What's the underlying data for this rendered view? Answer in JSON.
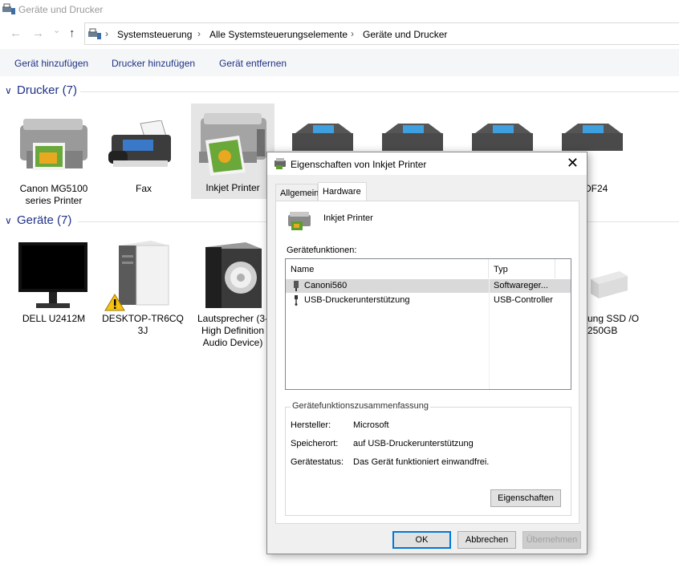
{
  "window": {
    "title": "Geräte und Drucker"
  },
  "nav": {
    "back": "←",
    "forward": "→",
    "dropdown": "⌄",
    "up": "↑"
  },
  "breadcrumb": [
    "Systemsteuerung",
    "Alle Systemsteuerungselemente",
    "Geräte und Drucker"
  ],
  "commands": [
    "Gerät hinzufügen",
    "Drucker hinzufügen",
    "Gerät entfernen"
  ],
  "groups": {
    "printers": {
      "title": "Drucker (7)",
      "chevron": "∨"
    },
    "devices": {
      "title": "Geräte (7)",
      "chevron": "∨"
    }
  },
  "printers": [
    {
      "label": "Canon MG5100 series Printer",
      "icon": "multifunction-printer-icon"
    },
    {
      "label": "Fax",
      "icon": "fax-icon"
    },
    {
      "label": "Inkjet Printer",
      "icon": "inkjet-printer-icon",
      "selected": true
    },
    {
      "label": "",
      "icon": "printer-icon"
    },
    {
      "label": "",
      "icon": "printer-icon"
    },
    {
      "label": "",
      "icon": "printer-icon"
    },
    {
      "label": "DF24",
      "icon": "printer-icon"
    }
  ],
  "devices": [
    {
      "label": "DELL U2412M",
      "icon": "monitor-icon"
    },
    {
      "label": "DESKTOP-TR6CQ 3J",
      "icon": "computer-tower-icon",
      "warning": true
    },
    {
      "label": "Lautsprecher (3- High Definition Audio Device)",
      "icon": "speaker-icon"
    },
    {
      "label": "ung SSD /O 250GB",
      "icon": "ssd-drive-icon"
    }
  ],
  "dialog": {
    "title": "Eigenschaften von Inkjet Printer",
    "close": "✕",
    "tabs": [
      "Allgemein",
      "Hardware"
    ],
    "active_tab": "Hardware",
    "device_name": "Inkjet Printer",
    "functions_label": "Gerätefunktionen:",
    "columns": [
      "Name",
      "Typ"
    ],
    "rows": [
      {
        "name": "Canoni560",
        "type": "Softwareger...",
        "selected": true
      },
      {
        "name": "USB-Druckerunterstützung",
        "type": "USB-Controller"
      }
    ],
    "summary": {
      "label": "Gerätefunktionszusammenfassung",
      "manufacturer_key": "Hersteller:",
      "manufacturer_val": "Microsoft",
      "location_key": "Speicherort:",
      "location_val": "auf USB-Druckerunterstützung",
      "status_key": "Gerätestatus:",
      "status_val": "Das Gerät funktioniert einwandfrei.",
      "properties_button": "Eigenschaften"
    },
    "buttons": {
      "ok": "OK",
      "cancel": "Abbrechen",
      "apply": "Übernehmen"
    }
  },
  "colors": {
    "link": "#1e3287",
    "selection": "#e5e5e5",
    "accent": "#0078d7"
  }
}
